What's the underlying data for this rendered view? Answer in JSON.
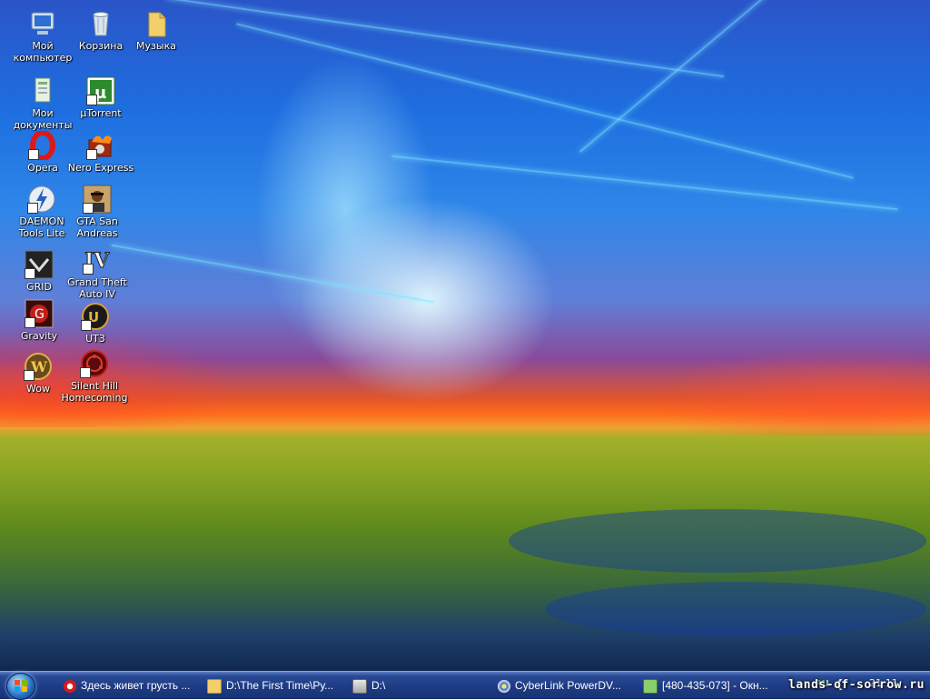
{
  "desktop": {
    "icons": [
      {
        "label": "Мой компьютер",
        "icon": "computer-icon"
      },
      {
        "label": "Корзина",
        "icon": "recycle-bin-icon"
      },
      {
        "label": "Музыка",
        "icon": "folder-icon"
      },
      {
        "label": "Мои документы",
        "icon": "documents-icon"
      },
      {
        "label": "µTorrent",
        "icon": "utorrent-icon"
      },
      {
        "label": "Opera",
        "icon": "opera-icon"
      },
      {
        "label": "Nero Express",
        "icon": "nero-icon"
      },
      {
        "label": "DAEMON Tools Lite",
        "icon": "daemon-tools-icon"
      },
      {
        "label": "GTA San Andreas",
        "icon": "gta-sa-icon"
      },
      {
        "label": "GRID",
        "icon": "grid-game-icon"
      },
      {
        "label": "Grand Theft Auto IV",
        "icon": "gta4-icon"
      },
      {
        "label": "Gravity",
        "icon": "gravity-icon"
      },
      {
        "label": "UT3",
        "icon": "ut3-icon"
      },
      {
        "label": "Wow",
        "icon": "wow-icon"
      },
      {
        "label": "Silent Hill Homecoming",
        "icon": "silent-hill-icon"
      }
    ]
  },
  "taskbar": {
    "tasks": [
      {
        "label": "Здесь живет грусть ...",
        "icon": "opera-icon"
      },
      {
        "label": "D:\\The First Time\\Ру...",
        "icon": "folder-icon"
      },
      {
        "label": "D:\\",
        "icon": "drive-icon"
      },
      {
        "label": "CyberLink PowerDV...",
        "icon": "powerdvd-icon"
      },
      {
        "label": "[480-435-073] - Окн...",
        "icon": "chat-window-icon"
      }
    ],
    "tray": {
      "language": "RU",
      "clock": "21:11",
      "watermark": "lands-of-sorrow.ru"
    }
  },
  "colors": {
    "taskbar_blue": "#1d3a82",
    "label_text": "#ffffff"
  }
}
